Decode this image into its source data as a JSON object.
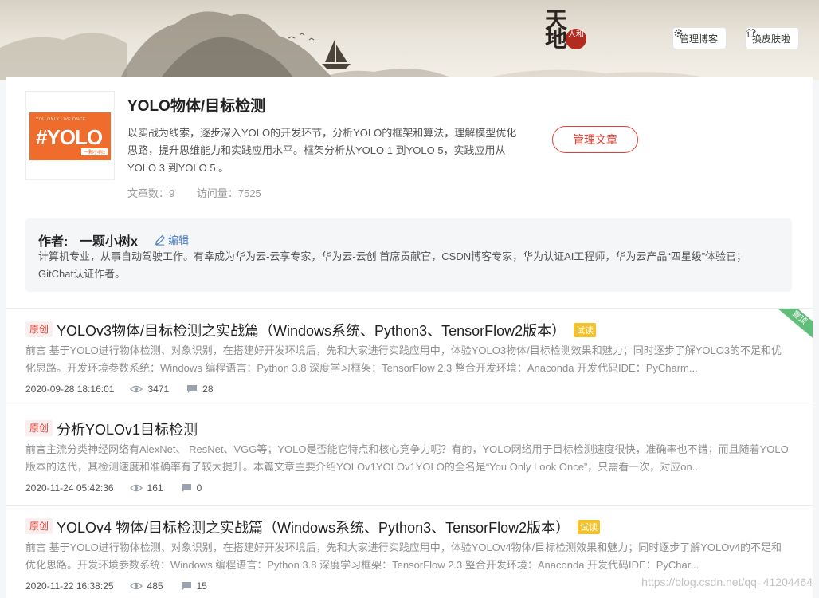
{
  "header": {
    "logo_text": "天地",
    "seal_text": "人和",
    "manage_blog_label": "管理博客",
    "change_skin_label": "换皮肤啦"
  },
  "column": {
    "cover": {
      "small_text": "YOU ONLY LIVE ONCE.",
      "big_text": "#YOLO",
      "tag_text": "一颗小树x"
    },
    "title": "YOLO物体/目标检测",
    "description": "以实战为线索，逐步深入YOLO的开发环节，分析YOLO的框架和算法，理解模型优化思路，提升思维能力和实践应用水平。框架分析从YOLO 1 到YOLO 5，实践应用从YOLO 3 到YOLO 5 。",
    "article_count": "文章数：9",
    "visit_count": "访问量：7525",
    "manage_articles_label": "管理文章"
  },
  "author": {
    "label": "作者:",
    "name": "一颗小树x",
    "edit_label": "编辑",
    "bio": "计算机专业，从事自动驾驶工作。有幸成为华为云-云享专家，华为云-云创 首席贡献官，CSDN博客专家，华为认证AI工程师，华为云产品“四星级”体验官；GitChat认证作者。"
  },
  "articles": [
    {
      "tag": "原创",
      "title": "YOLOv3物体/目标检测之实战篇（Windows系统、Python3、TensorFlow2版本）",
      "trial": "试读",
      "pinned": "置顶",
      "summary": "前言 基于YOLO进行物体检测、对象识别，在搭建好开发环境后，先和大家进行实践应用中，体验YOLO3物体/目标检测效果和魅力；同时逐步了解YOLO3的不足和优化思路。开发环境参数系统：Windows 编程语言：Python 3.8 深度学习框架：TensorFlow 2.3 整合开发环境：Anaconda 开发代码IDE：PyCharm...",
      "date": "2020-09-28 18:16:01",
      "views": "3471",
      "comments": "28"
    },
    {
      "tag": "原创",
      "title": "分析YOLOv1目标检测",
      "trial": "",
      "pinned": "",
      "summary": "前言主流分类神经网络有AlexNet、 ResNet、VGG等；YOLO是否能它特点和核心竞争力呢？有的，YOLO网络用于目标检测速度很快，准确率也不错；而且随着YOLO版本的迭代，其检测速度和准确率有了较大提升。本篇文章主要介绍YOLOv1YOLOv1YOLO的全名是“You Only Look Once”，只需看一次，对应on...",
      "date": "2020-11-24 05:42:36",
      "views": "161",
      "comments": "0"
    },
    {
      "tag": "原创",
      "title": "YOLOv4 物体/目标检测之实战篇（Windows系统、Python3、TensorFlow2版本）",
      "trial": "试读",
      "pinned": "",
      "summary": "前言 基于YOLO进行物体检测、对象识别，在搭建好开发环境后，先和大家进行实践应用中，体验YOLOv4物体/目标检测效果和魅力；同时逐步了解YOLOv4的不足和优化思路。开发环境参数系统：Windows 编程语言：Python 3.8 深度学习框架：TensorFlow 2.3 整合开发环境：Anaconda 开发代码IDE：PyChar...",
      "date": "2020-11-22 16:38:25",
      "views": "485",
      "comments": "15"
    }
  ],
  "watermark": "https://blog.csdn.net/qq_41204464"
}
